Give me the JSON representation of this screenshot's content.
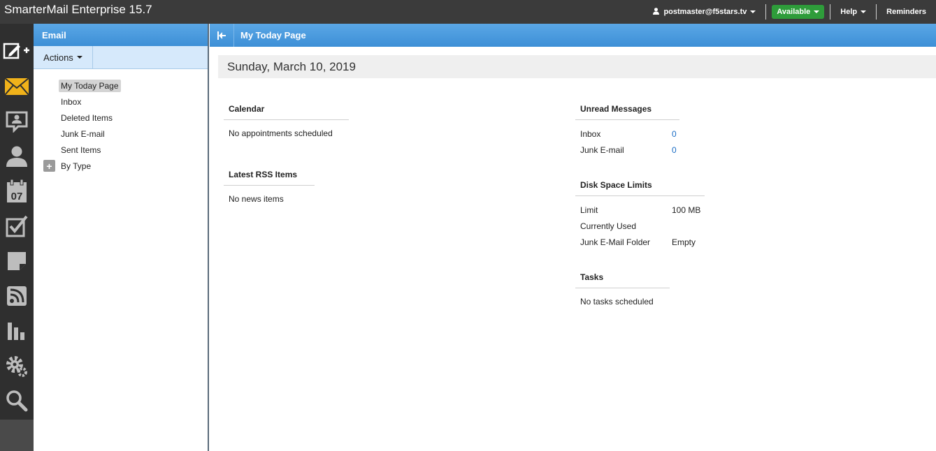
{
  "app": {
    "title": "SmarterMail Enterprise 15.7"
  },
  "topbar": {
    "user": "postmaster@f5stars.tv",
    "status": "Available",
    "help": "Help",
    "reminders": "Reminders"
  },
  "iconbar": {
    "icons": [
      "compose-icon",
      "email-icon",
      "chat-icon",
      "contacts-icon",
      "calendar-icon",
      "tasks-icon",
      "notes-icon",
      "rss-icon",
      "reports-icon",
      "settings-icon",
      "search-icon"
    ],
    "calendar_day": "07"
  },
  "folder_panel": {
    "header": "Email",
    "actions_label": "Actions",
    "folders": [
      {
        "label": "My Today Page",
        "selected": true
      },
      {
        "label": "Inbox"
      },
      {
        "label": "Deleted Items"
      },
      {
        "label": "Junk E-mail"
      },
      {
        "label": "Sent Items"
      },
      {
        "label": "By Type",
        "expandable": true
      }
    ],
    "expand_symbol": "+"
  },
  "main": {
    "title": "My Today Page",
    "date": "Sunday, March 10, 2019",
    "calendar": {
      "title": "Calendar",
      "text": "No appointments scheduled"
    },
    "rss": {
      "title": "Latest RSS Items",
      "text": "No news items"
    },
    "unread": {
      "title": "Unread Messages",
      "rows": [
        {
          "label": "Inbox",
          "value": "0"
        },
        {
          "label": "Junk E-mail",
          "value": "0"
        }
      ]
    },
    "disk": {
      "title": "Disk Space Limits",
      "rows": [
        {
          "label": "Limit",
          "value": "100 MB"
        },
        {
          "label": "Currently Used",
          "value": ""
        },
        {
          "label": "Junk E-Mail Folder",
          "value": "Empty"
        }
      ]
    },
    "tasks": {
      "title": "Tasks",
      "text": "No tasks scheduled"
    }
  },
  "colors": {
    "topbar": "#3b3b3b",
    "accent_blue": "#3d8fd6",
    "status_green": "#2e9c3a",
    "link_blue": "#1a6cc4",
    "mail_icon": "#f0b21a"
  }
}
